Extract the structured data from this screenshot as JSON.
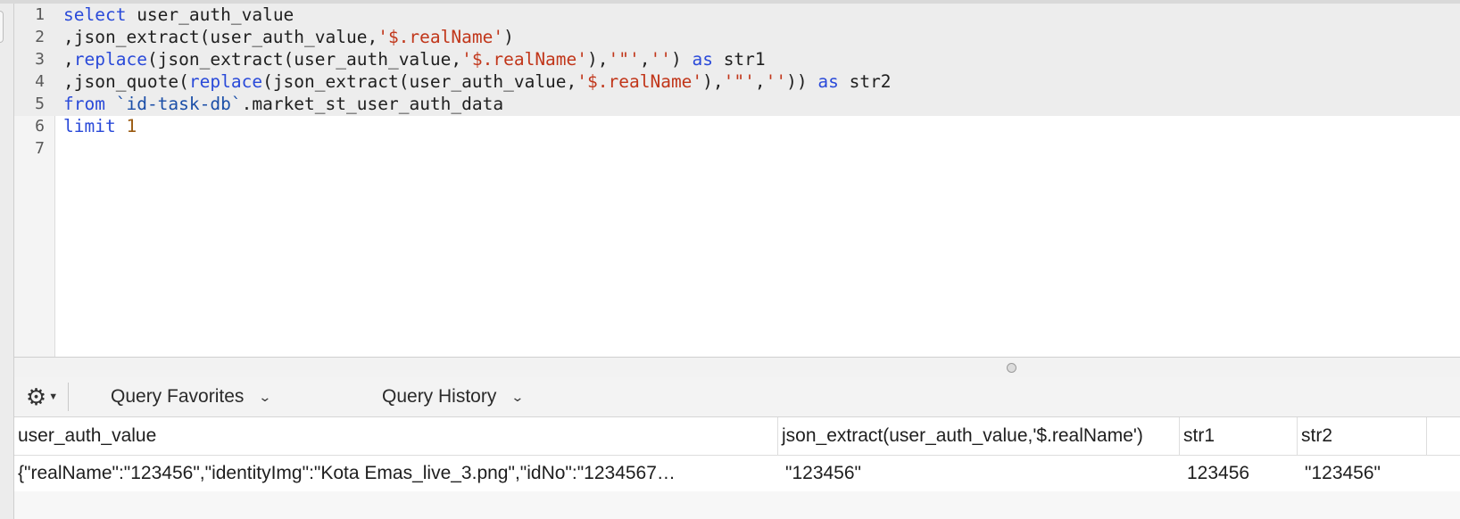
{
  "editor": {
    "lines": [
      {
        "num": "1",
        "tokens": [
          {
            "t": "select",
            "c": "kw"
          },
          {
            "t": " user_auth_value",
            "c": ""
          }
        ]
      },
      {
        "num": "2",
        "tokens": [
          {
            "t": ",json_extract(user_auth_value,",
            "c": ""
          },
          {
            "t": "'$.realName'",
            "c": "str"
          },
          {
            "t": ")",
            "c": ""
          }
        ]
      },
      {
        "num": "3",
        "tokens": [
          {
            "t": ",",
            "c": ""
          },
          {
            "t": "replace",
            "c": "kw"
          },
          {
            "t": "(json_extract(user_auth_value,",
            "c": ""
          },
          {
            "t": "'$.realName'",
            "c": "str"
          },
          {
            "t": "),",
            "c": ""
          },
          {
            "t": "'\"'",
            "c": "str"
          },
          {
            "t": ",",
            "c": ""
          },
          {
            "t": "''",
            "c": "str"
          },
          {
            "t": ") ",
            "c": ""
          },
          {
            "t": "as",
            "c": "kw"
          },
          {
            "t": " str1",
            "c": ""
          }
        ]
      },
      {
        "num": "4",
        "tokens": [
          {
            "t": ",json_quote(",
            "c": ""
          },
          {
            "t": "replace",
            "c": "kw"
          },
          {
            "t": "(json_extract(user_auth_value,",
            "c": ""
          },
          {
            "t": "'$.realName'",
            "c": "str"
          },
          {
            "t": "),",
            "c": ""
          },
          {
            "t": "'\"'",
            "c": "str"
          },
          {
            "t": ",",
            "c": ""
          },
          {
            "t": "''",
            "c": "str"
          },
          {
            "t": ")) ",
            "c": ""
          },
          {
            "t": "as",
            "c": "kw"
          },
          {
            "t": " str2",
            "c": ""
          }
        ]
      },
      {
        "num": "5",
        "tokens": [
          {
            "t": "from",
            "c": "kw"
          },
          {
            "t": " ",
            "c": ""
          },
          {
            "t": "`id-task-db`",
            "c": "bt"
          },
          {
            "t": ".market_st_user_auth_data",
            "c": ""
          }
        ]
      },
      {
        "num": "6",
        "tokens": [
          {
            "t": "limit",
            "c": "kw"
          },
          {
            "t": " ",
            "c": ""
          },
          {
            "t": "1",
            "c": "num"
          }
        ]
      },
      {
        "num": "7",
        "tokens": []
      }
    ]
  },
  "toolbar": {
    "gear_icon": "gear-icon",
    "favorites_label": "Query Favorites",
    "history_label": "Query History"
  },
  "results": {
    "columns": [
      "user_auth_value",
      "json_extract(user_auth_value,'$.realName')",
      "str1",
      "str2"
    ],
    "rows": [
      [
        "{\"realName\":\"123456\",\"identityImg\":\"Kota Emas_live_3.png\",\"idNo\":\"1234567…",
        "\"123456\"",
        "123456",
        "\"123456\""
      ]
    ]
  },
  "colors": {
    "keyword": "#2a4ad9",
    "string": "#c1361a",
    "number": "#9a5a10",
    "highlight": "#ededed"
  }
}
